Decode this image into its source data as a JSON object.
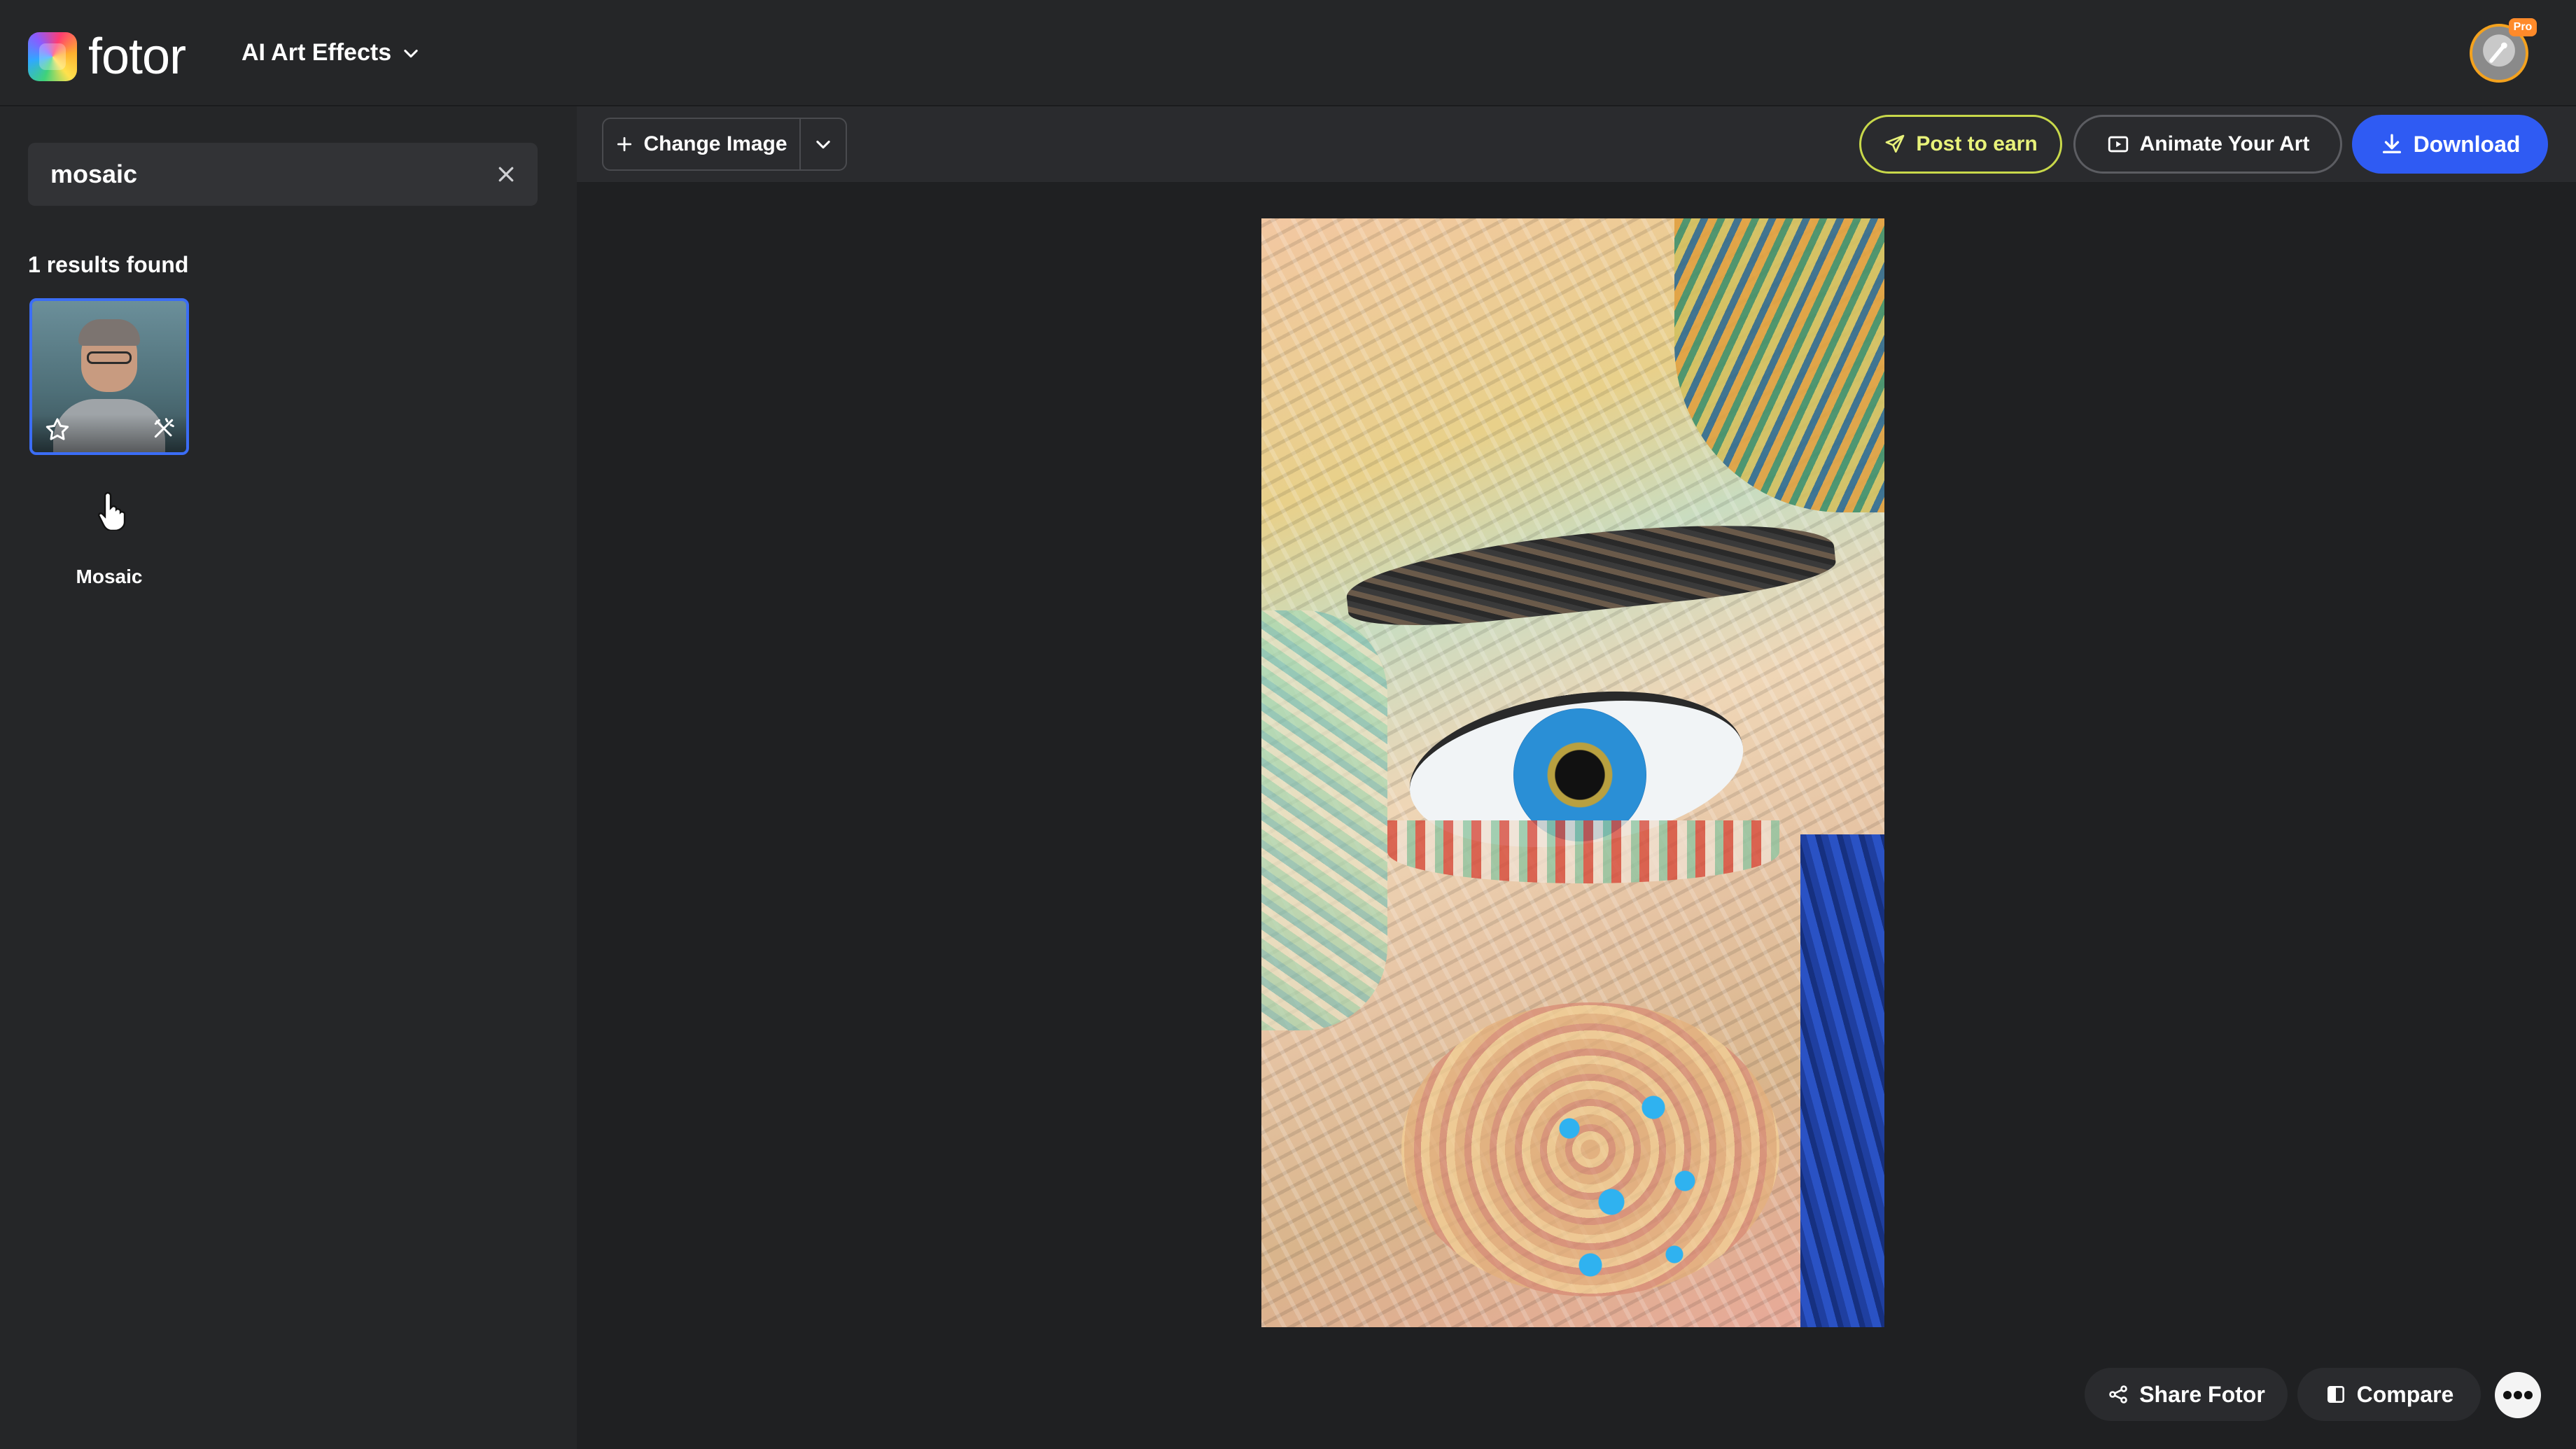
{
  "app": {
    "brand": "fotor",
    "menu_label": "AI Art Effects",
    "pro_badge": "Pro"
  },
  "sidebar": {
    "search": {
      "value": "mosaic",
      "placeholder": ""
    },
    "results_label": "1 results found",
    "results": [
      {
        "label": "Mosaic",
        "selected": true
      }
    ]
  },
  "toolbar": {
    "change_image_label": "Change Image",
    "post_to_earn_label": "Post to earn",
    "animate_label": "Animate Your Art",
    "download_label": "Download"
  },
  "footer": {
    "share_label": "Share Fotor",
    "compare_label": "Compare"
  },
  "icons": {
    "menu_chevron": "chevron-down-icon",
    "clear": "close-icon",
    "favorite": "star-icon",
    "apply": "magic-wand-icon",
    "add": "plus-icon",
    "post": "send-icon",
    "animate": "video-icon",
    "download": "download-icon",
    "share": "share-icon",
    "compare": "compare-icon",
    "more": "more-dots-icon"
  },
  "colors": {
    "accent": "#2f5bf3",
    "post_accent": "#c8d84a",
    "background": "#1f2022",
    "panel": "#252628",
    "selected_border": "#3b6df5"
  }
}
